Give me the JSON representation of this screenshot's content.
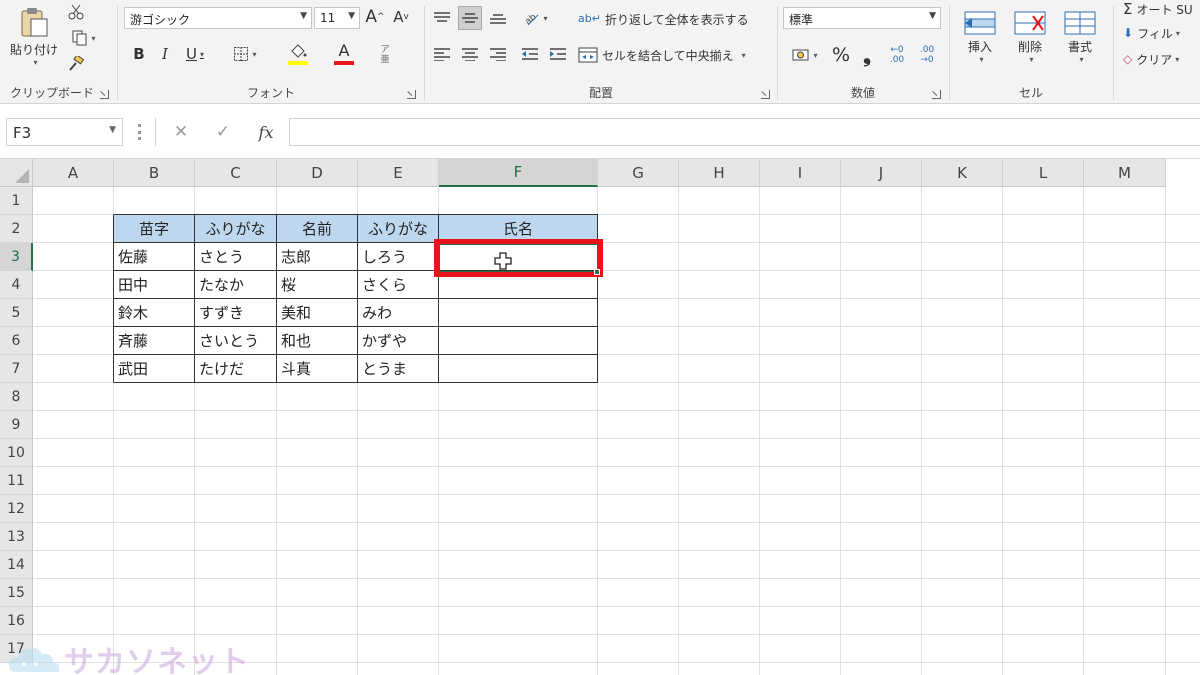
{
  "ribbon": {
    "clipboard": {
      "paste_label": "貼り付け",
      "group_label": "クリップボード"
    },
    "font": {
      "font_name": "游ゴシック",
      "font_size": "11",
      "grow_label": "A",
      "shrink_label": "A",
      "bold_label": "B",
      "italic_label": "I",
      "underline_label": "U",
      "font_color_label": "A",
      "phonetic_label": "ア亜",
      "group_label": "フォント",
      "fill_color": "#ffff00",
      "font_color": "#e8131b"
    },
    "alignment": {
      "wrap_text_label": "折り返して全体を表示する",
      "wrap_icon_label": "ab",
      "merge_center_label": "セルを結合して中央揃え",
      "group_label": "配置"
    },
    "number": {
      "format": "標準",
      "percent_label": "%",
      "comma_label": "❟",
      "inc_decimal_label": "←0 .00",
      "dec_decimal_label": ".00 →0",
      "group_label": "数値"
    },
    "cells": {
      "insert_label": "挿入",
      "delete_label": "削除",
      "format_label": "書式",
      "group_label": "セル"
    },
    "editing": {
      "autosum_label": "オート SU",
      "fill_label": "フィル",
      "clear_label": "クリア"
    }
  },
  "formula_bar": {
    "name_box": "F3",
    "fx_label": "fx",
    "cancel_label": "✕",
    "enter_label": "✓",
    "formula": ""
  },
  "sheet": {
    "columns": [
      "A",
      "B",
      "C",
      "D",
      "E",
      "F",
      "G",
      "H",
      "I",
      "J",
      "K",
      "L",
      "M"
    ],
    "rows": [
      "1",
      "2",
      "3",
      "4",
      "5",
      "6",
      "7",
      "8",
      "9",
      "10",
      "11",
      "12",
      "13",
      "14",
      "15",
      "16",
      "17"
    ],
    "selected_column": "F",
    "selected_row": "3",
    "active_cell": "F3",
    "table": {
      "headers": [
        "苗字",
        "ふりがな",
        "名前",
        "ふりがな",
        "氏名"
      ],
      "rows": [
        [
          "佐藤",
          "さとう",
          "志郎",
          "しろう",
          ""
        ],
        [
          "田中",
          "たなか",
          "桜",
          "さくら",
          ""
        ],
        [
          "鈴木",
          "すずき",
          "美和",
          "みわ",
          ""
        ],
        [
          "斉藤",
          "さいとう",
          "和也",
          "かずや",
          ""
        ],
        [
          "武田",
          "たけだ",
          "斗真",
          "とうま",
          ""
        ]
      ],
      "header_fill": "#bdd7ee"
    },
    "highlight_color": "#e8131b",
    "selection_color": "#217346"
  },
  "watermark": {
    "text": "サカソネット"
  }
}
